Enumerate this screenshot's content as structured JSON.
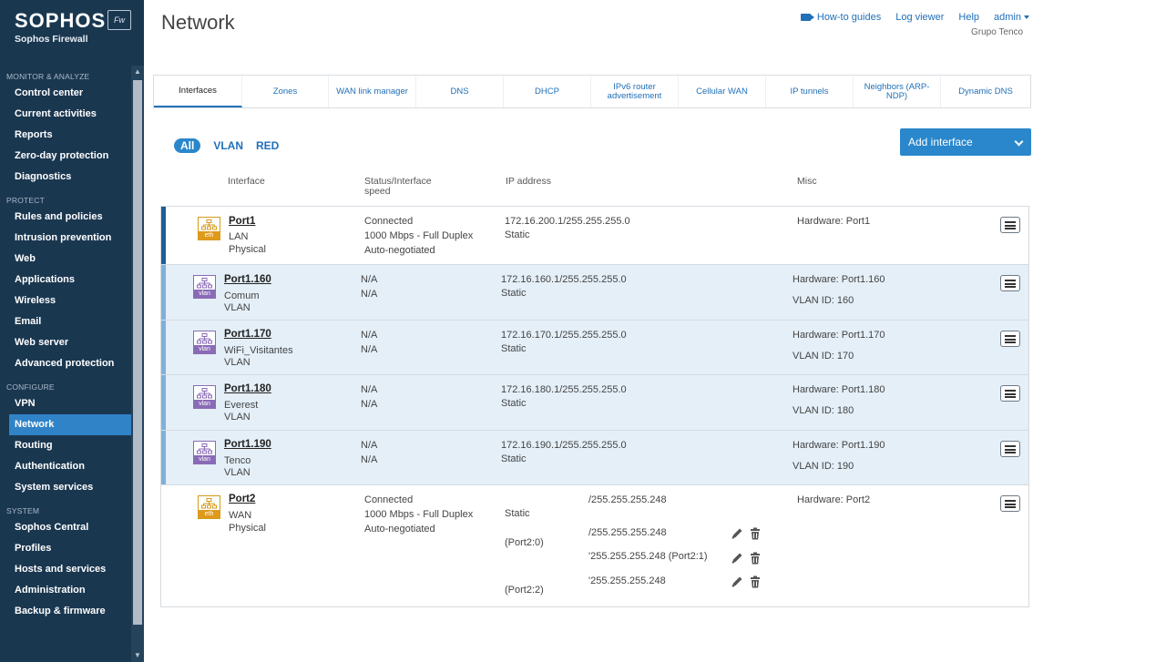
{
  "brand": {
    "logo": "SOPHOS",
    "badge": "Fw",
    "subtitle": "Sophos Firewall"
  },
  "sidebar": {
    "sections": [
      {
        "label": "MONITOR & ANALYZE",
        "items": [
          "Control center",
          "Current activities",
          "Reports",
          "Zero-day protection",
          "Diagnostics"
        ]
      },
      {
        "label": "PROTECT",
        "items": [
          "Rules and policies",
          "Intrusion prevention",
          "Web",
          "Applications",
          "Wireless",
          "Email",
          "Web server",
          "Advanced protection"
        ]
      },
      {
        "label": "CONFIGURE",
        "items": [
          "VPN",
          "Network",
          "Routing",
          "Authentication",
          "System services"
        ]
      },
      {
        "label": "SYSTEM",
        "items": [
          "Sophos Central",
          "Profiles",
          "Hosts and services",
          "Administration",
          "Backup & firmware"
        ]
      }
    ],
    "active": "Network"
  },
  "header": {
    "title": "Network",
    "links": {
      "guides": "How-to guides",
      "log": "Log viewer",
      "help": "Help",
      "user": "admin"
    },
    "org": "Grupo Tenco"
  },
  "tabs": [
    {
      "label": "Interfaces",
      "w": 97
    },
    {
      "label": "Zones",
      "w": 95
    },
    {
      "label": "WAN link manager",
      "w": 96
    },
    {
      "label": "DNS",
      "w": 96
    },
    {
      "label": "DHCP",
      "w": 96
    },
    {
      "label": "IPv6 router advertisement",
      "w": 96
    },
    {
      "label": "Cellular WAN",
      "w": 96
    },
    {
      "label": "IP tunnels",
      "w": 96
    },
    {
      "label": "Neighbors (ARP-NDP)",
      "w": 96
    },
    {
      "label": "Dynamic DNS",
      "w": 98
    }
  ],
  "filter": {
    "all": "All",
    "vlan": "VLAN",
    "red": "RED"
  },
  "add_button": "Add interface",
  "columns": {
    "interface": "Interface",
    "status": "Status/Interface speed",
    "ip": "IP address",
    "misc": "Misc"
  },
  "rows": {
    "port1": {
      "name": "Port1",
      "zone": "LAN",
      "type": "Physical",
      "icon": "eth",
      "status1": "Connected",
      "status2": "1000 Mbps - Full Duplex",
      "status3": "Auto-negotiated",
      "ip": "172.16.200.1/255.255.255.0",
      "mode": "Static",
      "hw": "Hardware:  Port1"
    },
    "p160": {
      "name": "Port1.160",
      "zone": "Comum",
      "type": "VLAN",
      "icon": "vlan",
      "status1": "N/A",
      "status2": "N/A",
      "ip": "172.16.160.1/255.255.255.0",
      "mode": "Static",
      "hw": "Hardware:  Port1.160",
      "vid": "VLAN ID: 160"
    },
    "p170": {
      "name": "Port1.170",
      "zone": "WiFi_Visitantes",
      "type": "VLAN",
      "icon": "vlan",
      "status1": "N/A",
      "status2": "N/A",
      "ip": "172.16.170.1/255.255.255.0",
      "mode": "Static",
      "hw": "Hardware:  Port1.170",
      "vid": "VLAN ID: 170"
    },
    "p180": {
      "name": "Port1.180",
      "zone": "Everest",
      "type": "VLAN",
      "icon": "vlan",
      "status1": "N/A",
      "status2": "N/A",
      "ip": "172.16.180.1/255.255.255.0",
      "mode": "Static",
      "hw": "Hardware:  Port1.180",
      "vid": "VLAN ID: 180"
    },
    "p190": {
      "name": "Port1.190",
      "zone": "Tenco",
      "type": "VLAN",
      "icon": "vlan",
      "status1": "N/A",
      "status2": "N/A",
      "ip": "172.16.190.1/255.255.255.0",
      "mode": "Static",
      "hw": "Hardware:  Port1.190",
      "vid": "VLAN ID: 190"
    },
    "port2": {
      "name": "Port2",
      "zone": "WAN",
      "type": "Physical",
      "icon": "eth",
      "status1": "Connected",
      "status2": "1000 Mbps - Full Duplex",
      "status3": "Auto-negotiated",
      "ip": "/255.255.255.248",
      "mode": "Static",
      "hw": "Hardware:  Port2",
      "aliases": [
        {
          "label": "(Port2:0)",
          "ip": "/255.255.255.248"
        },
        {
          "label": "",
          "ip": "'255.255.255.248 (Port2:1)"
        },
        {
          "label": "(Port2:2)",
          "ip": "'255.255.255.248"
        }
      ]
    }
  }
}
